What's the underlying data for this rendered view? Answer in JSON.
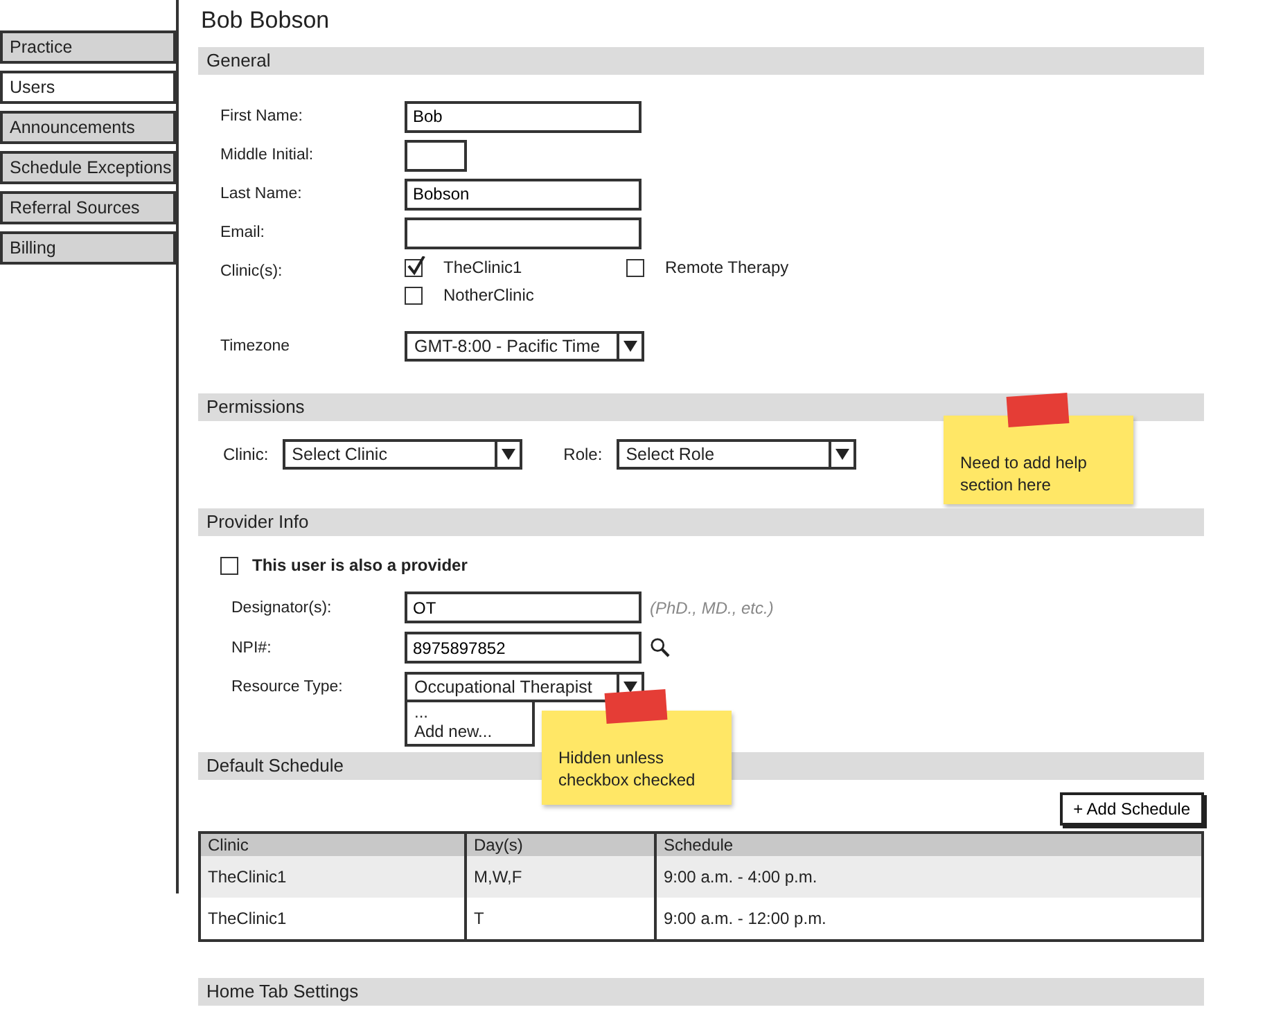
{
  "sidebar": {
    "items": [
      {
        "label": "Practice",
        "selected": false
      },
      {
        "label": "Users",
        "selected": true
      },
      {
        "label": "Announcements",
        "selected": false
      },
      {
        "label": "Schedule Exceptions",
        "selected": false
      },
      {
        "label": "Referral Sources",
        "selected": false
      },
      {
        "label": "Billing",
        "selected": false
      }
    ]
  },
  "page_title": "Bob Bobson",
  "general": {
    "title": "General",
    "fields": [
      {
        "label": "First Name:",
        "value": "Bob",
        "kind": "text"
      },
      {
        "label": "Middle Initial:",
        "kind": "short"
      },
      {
        "label": "Last Name:",
        "value": "Bobson",
        "kind": "text"
      },
      {
        "label": "Email:",
        "kind": "text"
      }
    ],
    "clinics": {
      "label": "Clinic(s):",
      "options": [
        {
          "label": "TheClinic1",
          "checked": true
        },
        {
          "label": "Remote Therapy",
          "checked": false
        },
        {
          "label": "NotherClinic",
          "checked": false
        }
      ]
    },
    "timezone": {
      "label": "Timezone",
      "value": "GMT-8:00 - Pacific Time"
    }
  },
  "permissions": {
    "title": "Permissions",
    "selects": [
      {
        "label": "Clinic:",
        "value": "Select Clinic"
      },
      {
        "label": "Role:",
        "value": "Select Role"
      }
    ],
    "note": "Need to add help section here"
  },
  "provider_info": {
    "title": "Provider Info",
    "provider_checkbox": {
      "label": "This user is also a provider",
      "checked": false
    },
    "designators": {
      "label": "Designator(s):",
      "value": "OT",
      "hint": "(PhD., MD., etc.)"
    },
    "npi": {
      "label": "NPI#:",
      "value": "8975897852"
    },
    "resource_type": {
      "label": "Resource Type:",
      "value": "Occupational Therapist",
      "options": [
        "...",
        "Add new..."
      ]
    },
    "note": "Hidden unless checkbox checked"
  },
  "default_schedule": {
    "title": "Default Schedule",
    "add_button": "+ Add Schedule",
    "table": {
      "columns": [
        "Clinic",
        "Day(s)",
        "Schedule"
      ],
      "rows": [
        [
          "TheClinic1",
          "M,W,F",
          "9:00 a.m. - 4:00 p.m."
        ],
        [
          "TheClinic1",
          "T",
          "9:00 a.m. - 12:00 p.m."
        ]
      ]
    }
  },
  "home_tab_settings": {
    "title": "Home Tab Settings"
  }
}
